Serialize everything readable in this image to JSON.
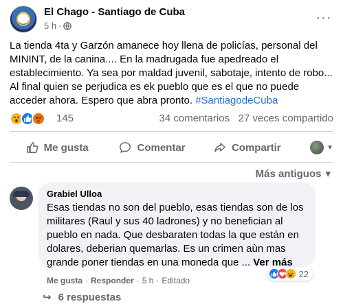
{
  "post": {
    "page_name": "El Chago - Santiago de Cuba",
    "time": "5 h",
    "separator": "·",
    "more_label": "···",
    "text": "La tienda 4ta y Garzón amanece hoy llena de policías, personal del MININT, de la canina.... En la madrugada fue apedreado el establecimiento. Ya sea por maldad juvenil, sabotaje, intento de robo... Al final quien se perjudica es ek pueblo que es el que no puede acceder ahora. Espero que abra pronto. ",
    "hashtag": "#SantiagodeCuba",
    "reactions": [
      "wow",
      "like",
      "angry"
    ],
    "reaction_count": "145",
    "comments_count": "34 comentarios",
    "shares_count": "27 veces compartido"
  },
  "actions": {
    "like": "Me gusta",
    "comment": "Comentar",
    "share": "Compartir"
  },
  "sort": {
    "label": "Más antiguos",
    "caret": "▾"
  },
  "comment": {
    "author": "Grabiel Ulloa",
    "text": "Esas tiendas no son del pueblo, esas tiendas son de los militares (Raul y sus 40 ladrones) y no benefician al pueblo en nada. Que desbaraten todas la que están en dolares, deberian quemarlas. Es un crimen aùn mas grande poner tiendas en una moneda que ... ",
    "see_more": "Ver más",
    "like": "Me gusta",
    "reply": "Responder",
    "dot": "·",
    "time": "5 h",
    "edited": "Editado",
    "reactions": [
      "like",
      "love",
      "haha"
    ],
    "reaction_count": "22"
  },
  "replies": {
    "arrow": "↪",
    "label": "6 respuestas"
  },
  "colors": {
    "link": "#216fdb",
    "muted": "#65676b",
    "bubble": "#f0f2f5",
    "like_blue": "#1877f2"
  }
}
